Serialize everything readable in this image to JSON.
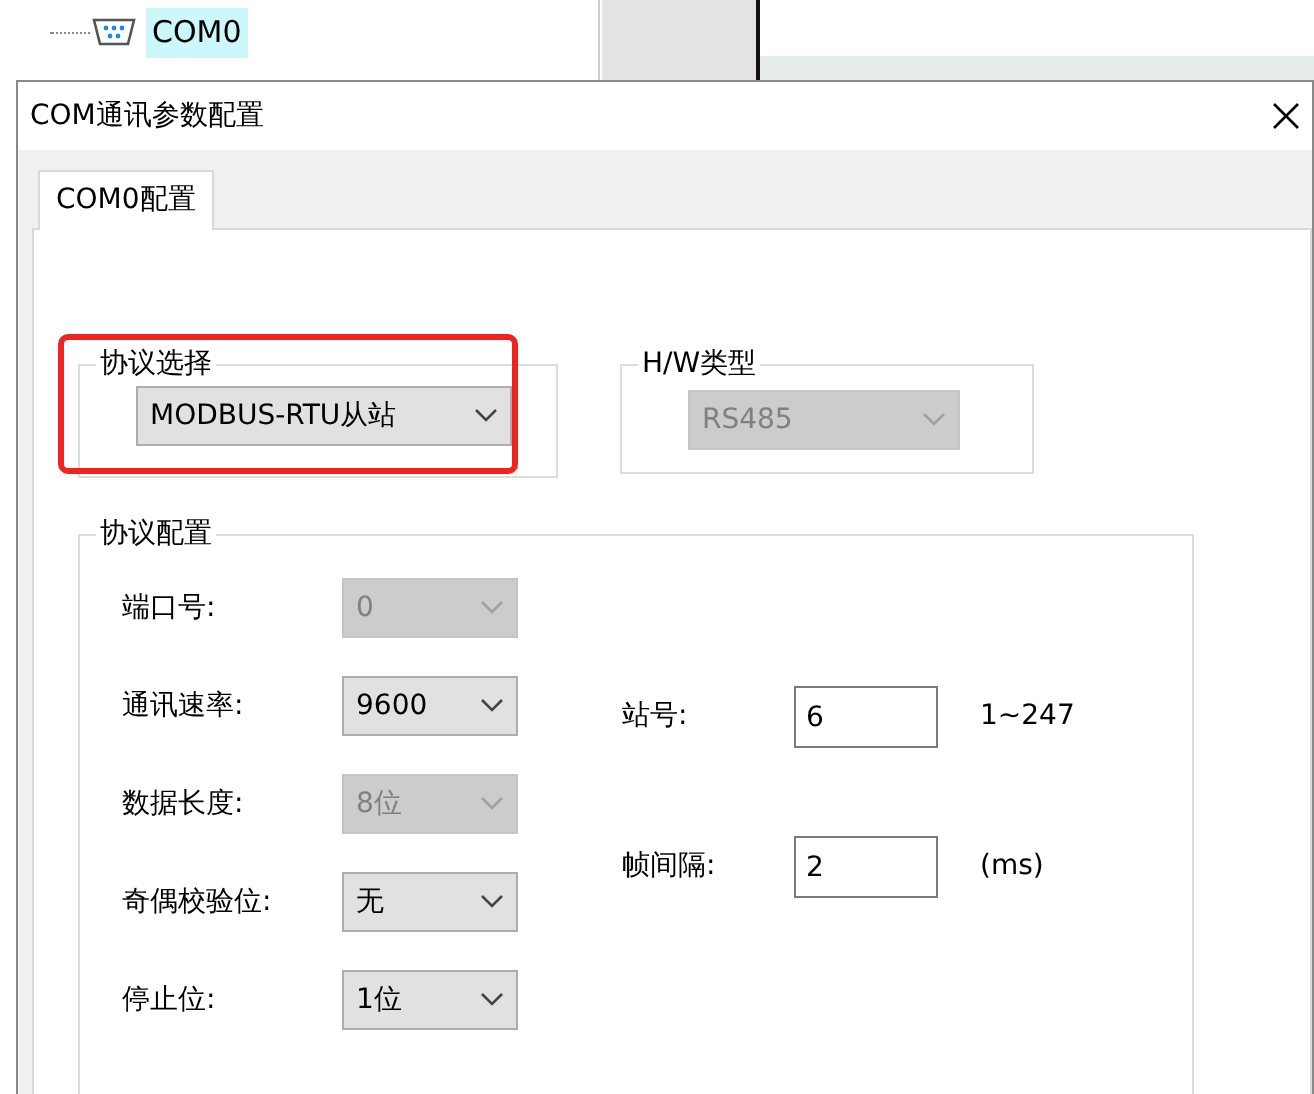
{
  "tree": {
    "items": [
      {
        "label": "COM0",
        "selected": true
      }
    ]
  },
  "dialog": {
    "title": "COM通讯参数配置",
    "tabs": [
      {
        "label": "COM0配置",
        "selected": true
      }
    ],
    "protocol_group": {
      "legend": "协议选择",
      "value": "MODBUS-RTU从站",
      "disabled": false,
      "highlighted": true
    },
    "hw_group": {
      "legend": "H/W类型",
      "value": "RS485",
      "disabled": true
    },
    "config_group": {
      "legend": "协议配置",
      "fields": [
        {
          "label": "端口号:",
          "value": "0",
          "disabled": true
        },
        {
          "label": "通讯速率:",
          "value": "9600",
          "disabled": false
        },
        {
          "label": "数据长度:",
          "value": "8位",
          "disabled": true
        },
        {
          "label": "奇偶校验位:",
          "value": "无",
          "disabled": false
        },
        {
          "label": "停止位:",
          "value": "1位",
          "disabled": false
        }
      ],
      "inputs": [
        {
          "label": "站号:",
          "value": "6",
          "hint": "1~247"
        },
        {
          "label": "帧间隔:",
          "value": "2",
          "hint": "(ms)"
        }
      ]
    }
  }
}
